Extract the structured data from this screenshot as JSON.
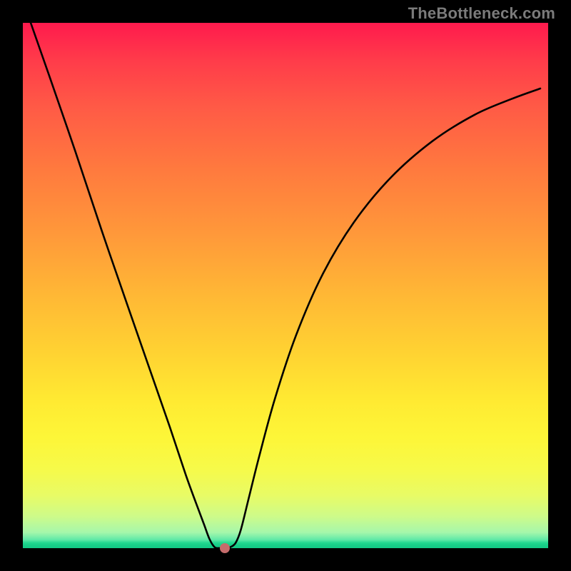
{
  "watermark": {
    "text": "TheBottleneck.com"
  },
  "chart_data": {
    "type": "line",
    "title": "",
    "xlabel": "",
    "ylabel": "",
    "xlim": [
      0,
      1
    ],
    "ylim": [
      0,
      1
    ],
    "series": [
      {
        "name": "curve",
        "x": [
          0.015,
          0.05,
          0.1,
          0.15,
          0.2,
          0.24,
          0.28,
          0.31,
          0.33,
          0.345,
          0.355,
          0.365,
          0.375,
          0.385,
          0.395,
          0.405,
          0.415,
          0.43,
          0.45,
          0.48,
          0.52,
          0.57,
          0.63,
          0.7,
          0.78,
          0.86,
          0.93,
          0.985
        ],
        "y": [
          1.0,
          0.9,
          0.755,
          0.605,
          0.46,
          0.345,
          0.23,
          0.14,
          0.085,
          0.045,
          0.018,
          0.002,
          0.0,
          0.0,
          0.002,
          0.01,
          0.035,
          0.095,
          0.175,
          0.285,
          0.405,
          0.52,
          0.62,
          0.705,
          0.775,
          0.825,
          0.855,
          0.875
        ]
      }
    ],
    "marker": {
      "x": 0.385,
      "y": 0.0
    },
    "gradient_stops": [
      {
        "pos": 0.0,
        "color": "#ff1a4d"
      },
      {
        "pos": 0.4,
        "color": "#ff983a"
      },
      {
        "pos": 0.72,
        "color": "#ffea32"
      },
      {
        "pos": 0.94,
        "color": "#cdfb8a"
      },
      {
        "pos": 1.0,
        "color": "#14c985"
      }
    ]
  }
}
